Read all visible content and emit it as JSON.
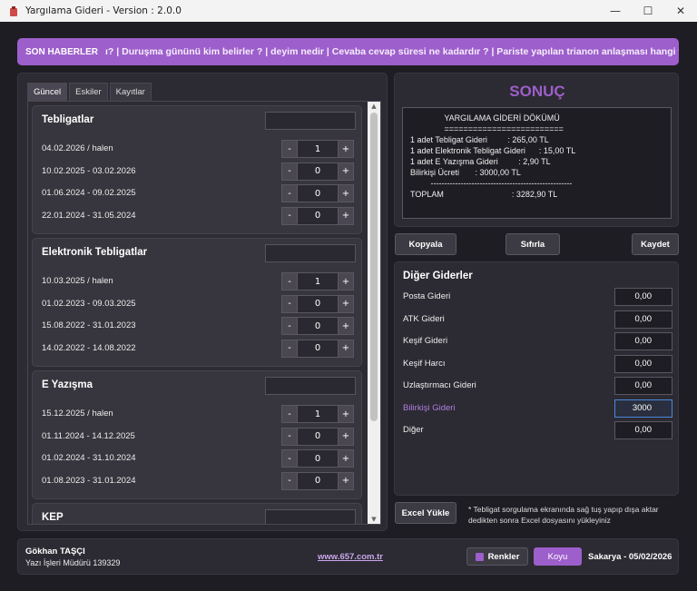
{
  "window": {
    "title": "Yargılama Gideri - Version : 2.0.0",
    "controls": [
      "—",
      "☐",
      "✕"
    ]
  },
  "news": {
    "label": "SON HABERLER",
    "ticker": "ı? | Duruşma gününü kim belirler ? | deyim nedir | Cevaba cevap süresi ne kadardır ? | Pariste yapılan trianon anlaşması hangi tarihte"
  },
  "tabs": [
    "Güncel",
    "Eskiler",
    "Kayıtlar"
  ],
  "groups": [
    {
      "title": "Tebligatlar",
      "rows": [
        {
          "date": "04.02.2026 / halen",
          "value": "1"
        },
        {
          "date": "10.02.2025 - 03.02.2026",
          "value": "0"
        },
        {
          "date": "01.06.2024 - 09.02.2025",
          "value": "0"
        },
        {
          "date": "22.01.2024 - 31.05.2024",
          "value": "0"
        }
      ]
    },
    {
      "title": "Elektronik Tebligatlar",
      "rows": [
        {
          "date": "10.03.2025 / halen",
          "value": "1"
        },
        {
          "date": "01.02.2023 - 09.03.2025",
          "value": "0"
        },
        {
          "date": "15.08.2022 - 31.01.2023",
          "value": "0"
        },
        {
          "date": "14.02.2022 - 14.08.2022",
          "value": "0"
        }
      ]
    },
    {
      "title": "E Yazışma",
      "rows": [
        {
          "date": "15.12.2025 / halen",
          "value": "1"
        },
        {
          "date": "01.11.2024 - 14.12.2025",
          "value": "0"
        },
        {
          "date": "01.02.2024 - 31.10.2024",
          "value": "0"
        },
        {
          "date": "01.08.2023 - 31.01.2024",
          "value": "0"
        }
      ]
    },
    {
      "title": "KEP",
      "rows": []
    }
  ],
  "stepper": {
    "minus": "-",
    "plus": "+"
  },
  "result": {
    "title": "SONUÇ",
    "receipt": "               YARGILAMA GİDERİ DÖKÜMÜ\n               =========================\n1 adet Tebligat Gideri         : 265,00 TL\n1 adet Elektronik Tebligat Gideri      : 15,00 TL\n1 adet E Yazışma Gideri         : 2,90 TL\nBilirkişi Ücreti       : 3000,00 TL\n         ----------------------------------------------------\nTOPLAM                              : 3282,90 TL"
  },
  "actions": {
    "copy": "Kopyala",
    "reset": "Sıfırla",
    "save": "Kaydet"
  },
  "other": {
    "title": "Diğer Giderler",
    "items": [
      {
        "label": "Posta Gideri",
        "value": "0,00"
      },
      {
        "label": "ATK Gideri",
        "value": "0,00"
      },
      {
        "label": "Keşif Gideri",
        "value": "0,00"
      },
      {
        "label": "Keşif Harcı",
        "value": "0,00"
      },
      {
        "label": "Uzlaştırmacı Gideri",
        "value": "0,00"
      },
      {
        "label": "Bilirkişi Gideri",
        "value": "3000"
      },
      {
        "label": "Diğer",
        "value": "0,00"
      }
    ]
  },
  "excel": {
    "button": "Excel Yükle",
    "note": "* Tebligat sorgulama ekranında sağ tuş yapıp dışa aktar dedikten sonra Excel dosyasını yükleyiniz"
  },
  "footer": {
    "name": "Gökhan TAŞÇI",
    "title": "Yazı İşleri Müdürü 139329",
    "link": "www.657.com.tr",
    "colors_button": "Renkler",
    "theme_button": "Koyu",
    "location_date": "Sakarya - 05/02/2026"
  },
  "colors": {
    "accent": "#9d5fcb",
    "background": "#1f1d24",
    "panel": "#2c2a32"
  }
}
